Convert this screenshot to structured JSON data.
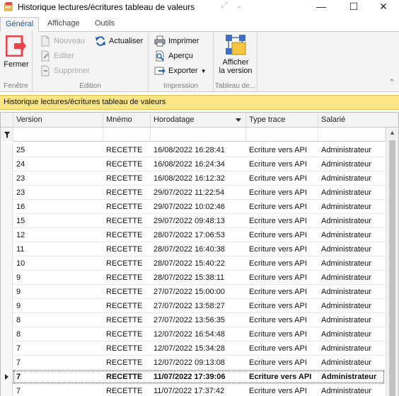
{
  "window": {
    "title": "Historique lectures/écritures tableau de valeurs",
    "extra_glyphs": "⤢",
    "minimize": "—",
    "maximize": "☐",
    "close": "✕"
  },
  "ribbon": {
    "tabs": [
      "Général",
      "Affichage",
      "Outils"
    ],
    "groups": {
      "fenetre": {
        "label": "Fenêtre",
        "fermer": "Fermer"
      },
      "edition": {
        "label": "Edition",
        "nouveau": "Nouveau",
        "editer": "Editer",
        "supprimer": "Supprimer",
        "actualiser": "Actualiser"
      },
      "impression": {
        "label": "Impression",
        "imprimer": "Imprimer",
        "apercu": "Aperçu",
        "exporter": "Exporter"
      },
      "tableau": {
        "label": "Tableau de...",
        "afficher_line1": "Afficher",
        "afficher_line2": "la version"
      }
    },
    "colors": {
      "fermer_icon": "#e8424d",
      "actualiser_icon": "#1f5fb4"
    }
  },
  "caption": "Historique lectures/écritures tableau de valeurs",
  "grid": {
    "columns": [
      "Version",
      "Mnémo",
      "Horodatage",
      "Type trace",
      "Salarié"
    ],
    "filter_icon": "filter-icon",
    "rows": [
      [
        "25",
        "RECETTE",
        "16/08/2022 16:28:41",
        "Ecriture vers API",
        "Administrateur"
      ],
      [
        "24",
        "RECETTE",
        "16/08/2022 16:24:34",
        "Ecriture vers API",
        "Administrateur"
      ],
      [
        "23",
        "RECETTE",
        "16/08/2022 16:12:32",
        "Ecriture vers API",
        "Administrateur"
      ],
      [
        "23",
        "RECETTE",
        "29/07/2022 11:22:54",
        "Ecriture vers API",
        "Administrateur"
      ],
      [
        "16",
        "RECETTE",
        "29/07/2022 10:02:46",
        "Ecriture vers API",
        "Administrateur"
      ],
      [
        "15",
        "RECETTE",
        "29/07/2022 09:48:13",
        "Ecriture vers API",
        "Administrateur"
      ],
      [
        "12",
        "RECETTE",
        "28/07/2022 17:06:53",
        "Ecriture vers API",
        "Administrateur"
      ],
      [
        "11",
        "RECETTE",
        "28/07/2022 16:40:38",
        "Ecriture vers API",
        "Administrateur"
      ],
      [
        "10",
        "RECETTE",
        "28/07/2022 15:40:22",
        "Ecriture vers API",
        "Administrateur"
      ],
      [
        "9",
        "RECETTE",
        "28/07/2022 15:38:11",
        "Ecriture vers API",
        "Administrateur"
      ],
      [
        "9",
        "RECETTE",
        "27/07/2022 15:00:00",
        "Ecriture vers API",
        "Administrateur"
      ],
      [
        "9",
        "RECETTE",
        "27/07/2022 13:58:27",
        "Ecriture vers API",
        "Administrateur"
      ],
      [
        "8",
        "RECETTE",
        "27/07/2022 13:56:35",
        "Ecriture vers API",
        "Administrateur"
      ],
      [
        "8",
        "RECETTE",
        "12/07/2022 16:54:48",
        "Ecriture vers API",
        "Administrateur"
      ],
      [
        "7",
        "RECETTE",
        "12/07/2022 15:34:28",
        "Ecriture vers API",
        "Administrateur"
      ],
      [
        "7",
        "RECETTE",
        "12/07/2022 09:13:08",
        "Ecriture vers API",
        "Administrateur"
      ],
      [
        "7",
        "RECETTE",
        "11/07/2022 17:39:06",
        "Ecriture vers API",
        "Administrateur"
      ],
      [
        "7",
        "RECETTE",
        "11/07/2022 17:37:42",
        "Ecriture vers API",
        "Administrateur"
      ]
    ],
    "selected_row": 16
  }
}
